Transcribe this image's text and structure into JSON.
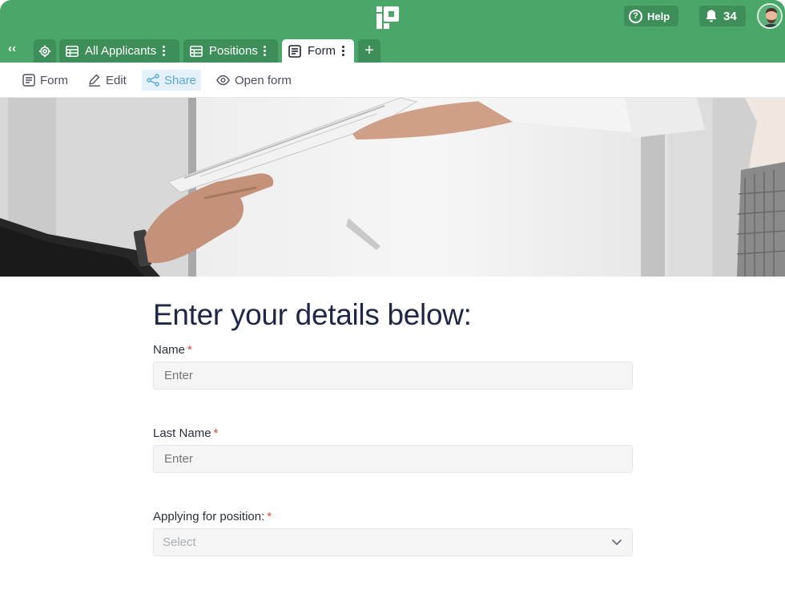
{
  "topbar": {
    "logo_icon": "app-logo",
    "help_label": "Help",
    "help_icon": "question-circle-icon",
    "notifications_count": "34",
    "notifications_icon": "bell-icon",
    "avatar_icon": "user-avatar",
    "brand_color": "#4ba66a"
  },
  "tabs": {
    "collapse_label": "‹‹",
    "items": [
      {
        "label": "All Applicants",
        "icon": "grid-table-icon"
      },
      {
        "label": "Positions",
        "icon": "grid-table-icon"
      },
      {
        "label": "Form",
        "icon": "form-icon",
        "active": true
      }
    ],
    "add_label": "+"
  },
  "toolbar": {
    "form_label": "Form",
    "edit_label": "Edit",
    "share_label": "Share",
    "open_form_label": "Open form"
  },
  "form": {
    "title": "Enter your details below:",
    "name": {
      "label": "Name",
      "required_mark": "*",
      "placeholder": "Enter"
    },
    "last_name": {
      "label": "Last Name",
      "required_mark": "*",
      "placeholder": "Enter"
    },
    "position": {
      "label": "Applying for position:",
      "required_mark": "*",
      "placeholder": "Select"
    }
  }
}
